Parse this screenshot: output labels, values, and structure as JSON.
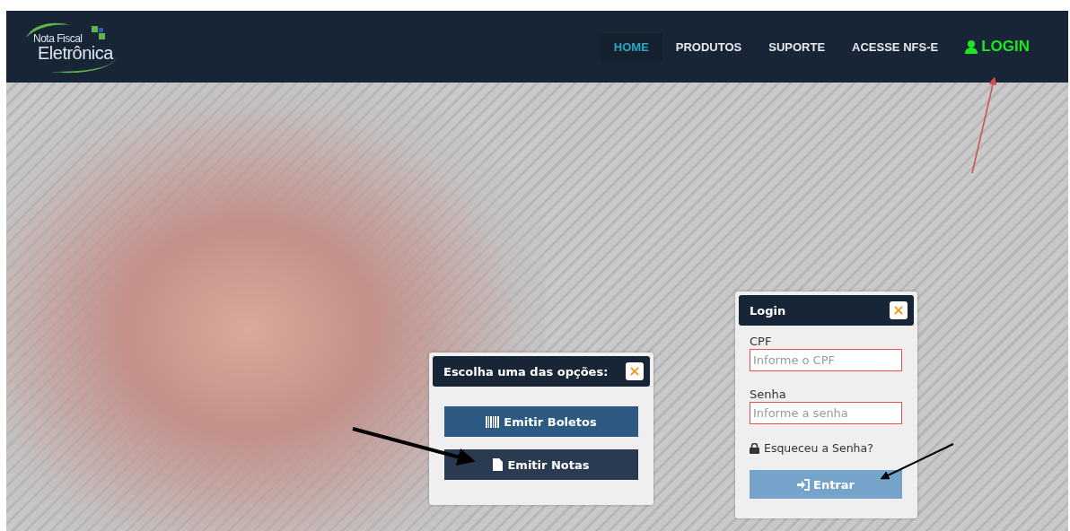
{
  "logo": {
    "line1": "Nota Fiscal",
    "line2": "Eletrônica"
  },
  "nav": [
    {
      "label": "HOME",
      "selected": true,
      "kind": "link"
    },
    {
      "label": "PRODUTOS",
      "selected": false,
      "kind": "link"
    },
    {
      "label": "SUPORTE",
      "selected": false,
      "kind": "link"
    },
    {
      "label": "ACESSE NFS-E",
      "selected": false,
      "kind": "link"
    },
    {
      "label": "LOGIN",
      "selected": false,
      "kind": "login"
    }
  ],
  "options_dialog": {
    "title": "Escolha uma das opções:",
    "close": "×",
    "buttons": [
      {
        "label": "Emitir Boletos",
        "kind": "barcode"
      },
      {
        "label": "Emitir Notas",
        "kind": "document"
      }
    ]
  },
  "login_dialog": {
    "title": "Login",
    "close": "×",
    "fields": [
      {
        "label": "CPF",
        "placeholder": "Informe o CPF"
      },
      {
        "label": "Senha",
        "placeholder": "Informe a senha"
      }
    ],
    "forgot": "Esqueceu a Senha?",
    "submit": "Entrar"
  }
}
